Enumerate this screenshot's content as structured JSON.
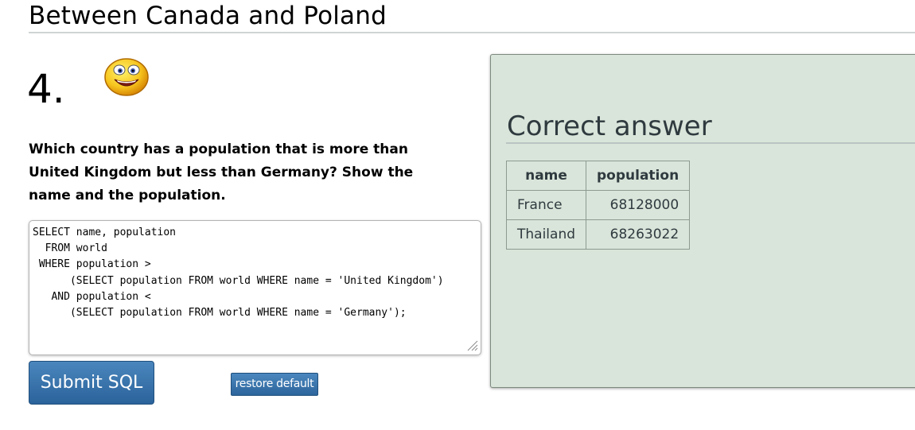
{
  "section": {
    "title": "Between Canada and Poland"
  },
  "question": {
    "number": "4.",
    "text": "Which country has a population that is more than United Kingdom but less than Germany? Show the name and the population.",
    "icon": "smiley-face-icon"
  },
  "editor": {
    "sql": "SELECT name, population\n  FROM world\n WHERE population >\n      (SELECT population FROM world WHERE name = 'United Kingdom')\n   AND population <\n      (SELECT population FROM world WHERE name = 'Germany');"
  },
  "buttons": {
    "submit_label": "Submit SQL",
    "restore_label": "restore default"
  },
  "answer": {
    "title": "Correct answer",
    "columns": [
      "name",
      "population"
    ],
    "rows": [
      [
        "France",
        "68128000"
      ],
      [
        "Thailand",
        "68263022"
      ]
    ]
  },
  "colors": {
    "panel_bg": "#d9e5da",
    "button_blue": "#2b639b"
  }
}
